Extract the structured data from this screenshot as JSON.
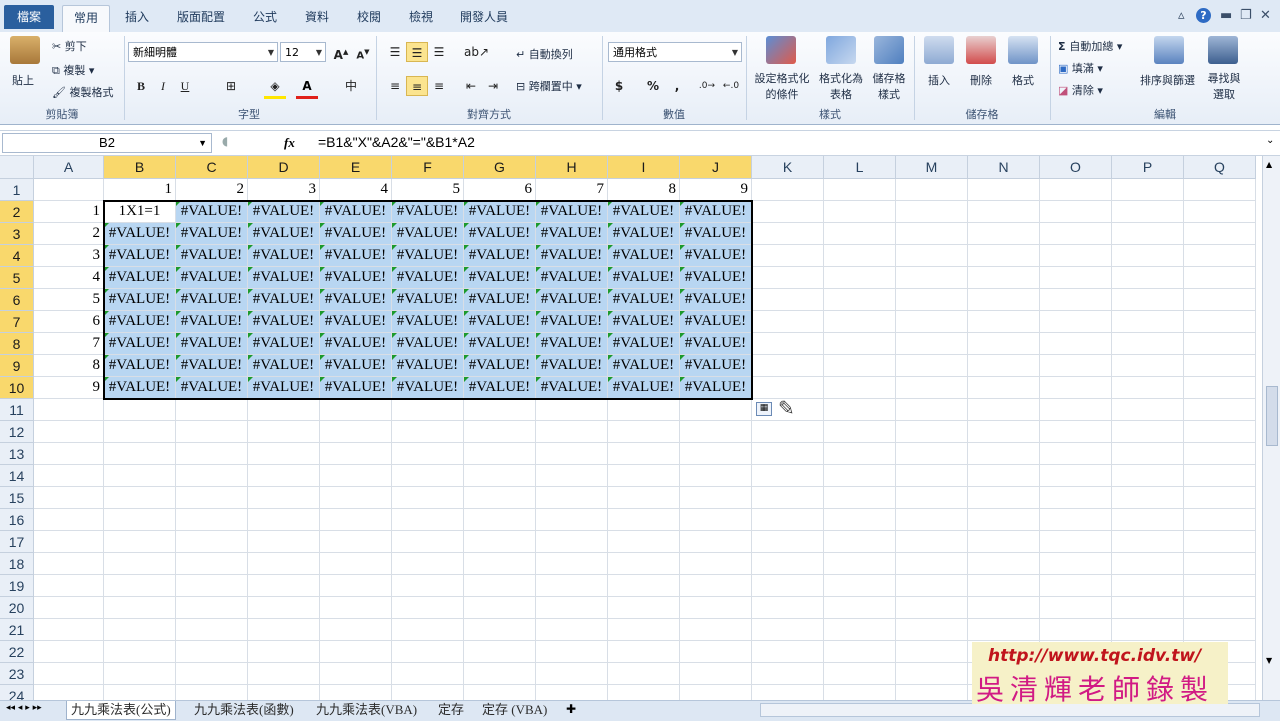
{
  "tabs": {
    "file": "檔案",
    "items": [
      "常用",
      "插入",
      "版面配置",
      "公式",
      "資料",
      "校閱",
      "檢視",
      "開發人員"
    ],
    "active": "常用"
  },
  "clipboard": {
    "paste": "貼上",
    "cut": "剪下",
    "copy": "複製",
    "format_painter": "複製格式",
    "label": "剪貼簿"
  },
  "font": {
    "name": "新細明體",
    "size": "12",
    "label": "字型",
    "bold": "B",
    "italic": "I",
    "underline": "U"
  },
  "alignment": {
    "wrap": "自動換列",
    "merge": "跨欄置中",
    "label": "對齊方式"
  },
  "number": {
    "format": "通用格式",
    "label": "數值",
    "currency": "$",
    "percent": "%",
    "comma": ","
  },
  "styles": {
    "conditional": [
      "設定格式化",
      "的條件"
    ],
    "as_table": [
      "格式化為",
      "表格"
    ],
    "cell_styles": [
      "儲存格",
      "樣式"
    ],
    "label": "樣式"
  },
  "cells": {
    "insert": "插入",
    "delete": "刪除",
    "format": "格式",
    "label": "儲存格"
  },
  "editing": {
    "autosum": "自動加總",
    "fill": "填滿",
    "clear": "清除",
    "sort": "排序與篩選",
    "find": [
      "尋找與",
      "選取"
    ],
    "label": "編輯"
  },
  "formula_bar": {
    "name_box": "B2",
    "fx": "fx",
    "formula": "=B1&\"X\"&A2&\"=\"&B1*A2"
  },
  "columns": [
    "A",
    "B",
    "C",
    "D",
    "E",
    "F",
    "G",
    "H",
    "I",
    "J",
    "K",
    "L",
    "M",
    "N",
    "O",
    "P",
    "Q"
  ],
  "rows": [
    "1",
    "2",
    "3",
    "4",
    "5",
    "6",
    "7",
    "8",
    "9",
    "10",
    "11",
    "12",
    "13",
    "14",
    "15",
    "16",
    "17",
    "18",
    "19",
    "20",
    "21",
    "22",
    "23",
    "24"
  ],
  "sheet": {
    "row1": [
      "1",
      "2",
      "3",
      "4",
      "5",
      "6",
      "7",
      "8",
      "9"
    ],
    "colA": [
      "1",
      "2",
      "3",
      "4",
      "5",
      "6",
      "7",
      "8",
      "9"
    ],
    "b2": "1X1=1",
    "error": "#VALUE!"
  },
  "sheet_tabs": [
    "九九乘法表(公式)",
    "九九乘法表(函數)",
    "九九乘法表(VBA)",
    "定存",
    "定存 (VBA)"
  ],
  "watermark": {
    "url": "http://www.tqc.idv.tw/",
    "author": "吳清輝老師錄製"
  }
}
